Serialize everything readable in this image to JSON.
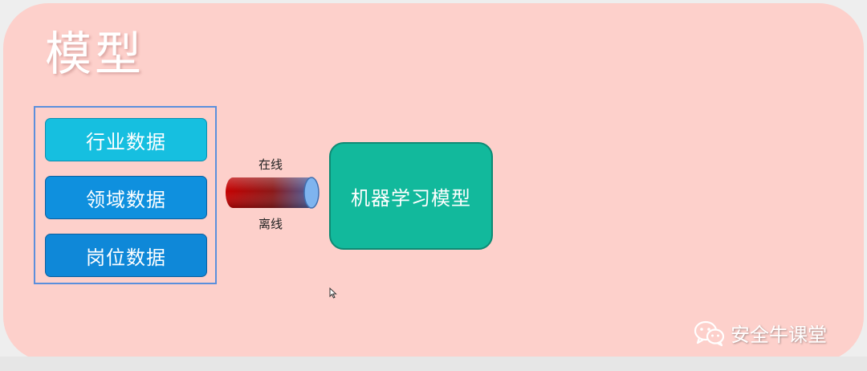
{
  "title": "模型",
  "data_sources": [
    {
      "label": "行业数据"
    },
    {
      "label": "领域数据"
    },
    {
      "label": "岗位数据"
    }
  ],
  "connector": {
    "top_label": "在线",
    "bottom_label": "离线"
  },
  "model": {
    "label": "机器学习模型"
  },
  "watermark": {
    "text": "安全牛课堂",
    "icon": "wechat-icon"
  },
  "colors": {
    "background": "#fdd0cb",
    "source_top": "#16bfe0",
    "source_other": "#0f90de",
    "model": "#12b99c",
    "pipe_start": "#c40000",
    "pipe_end": "#4a6fb3"
  }
}
